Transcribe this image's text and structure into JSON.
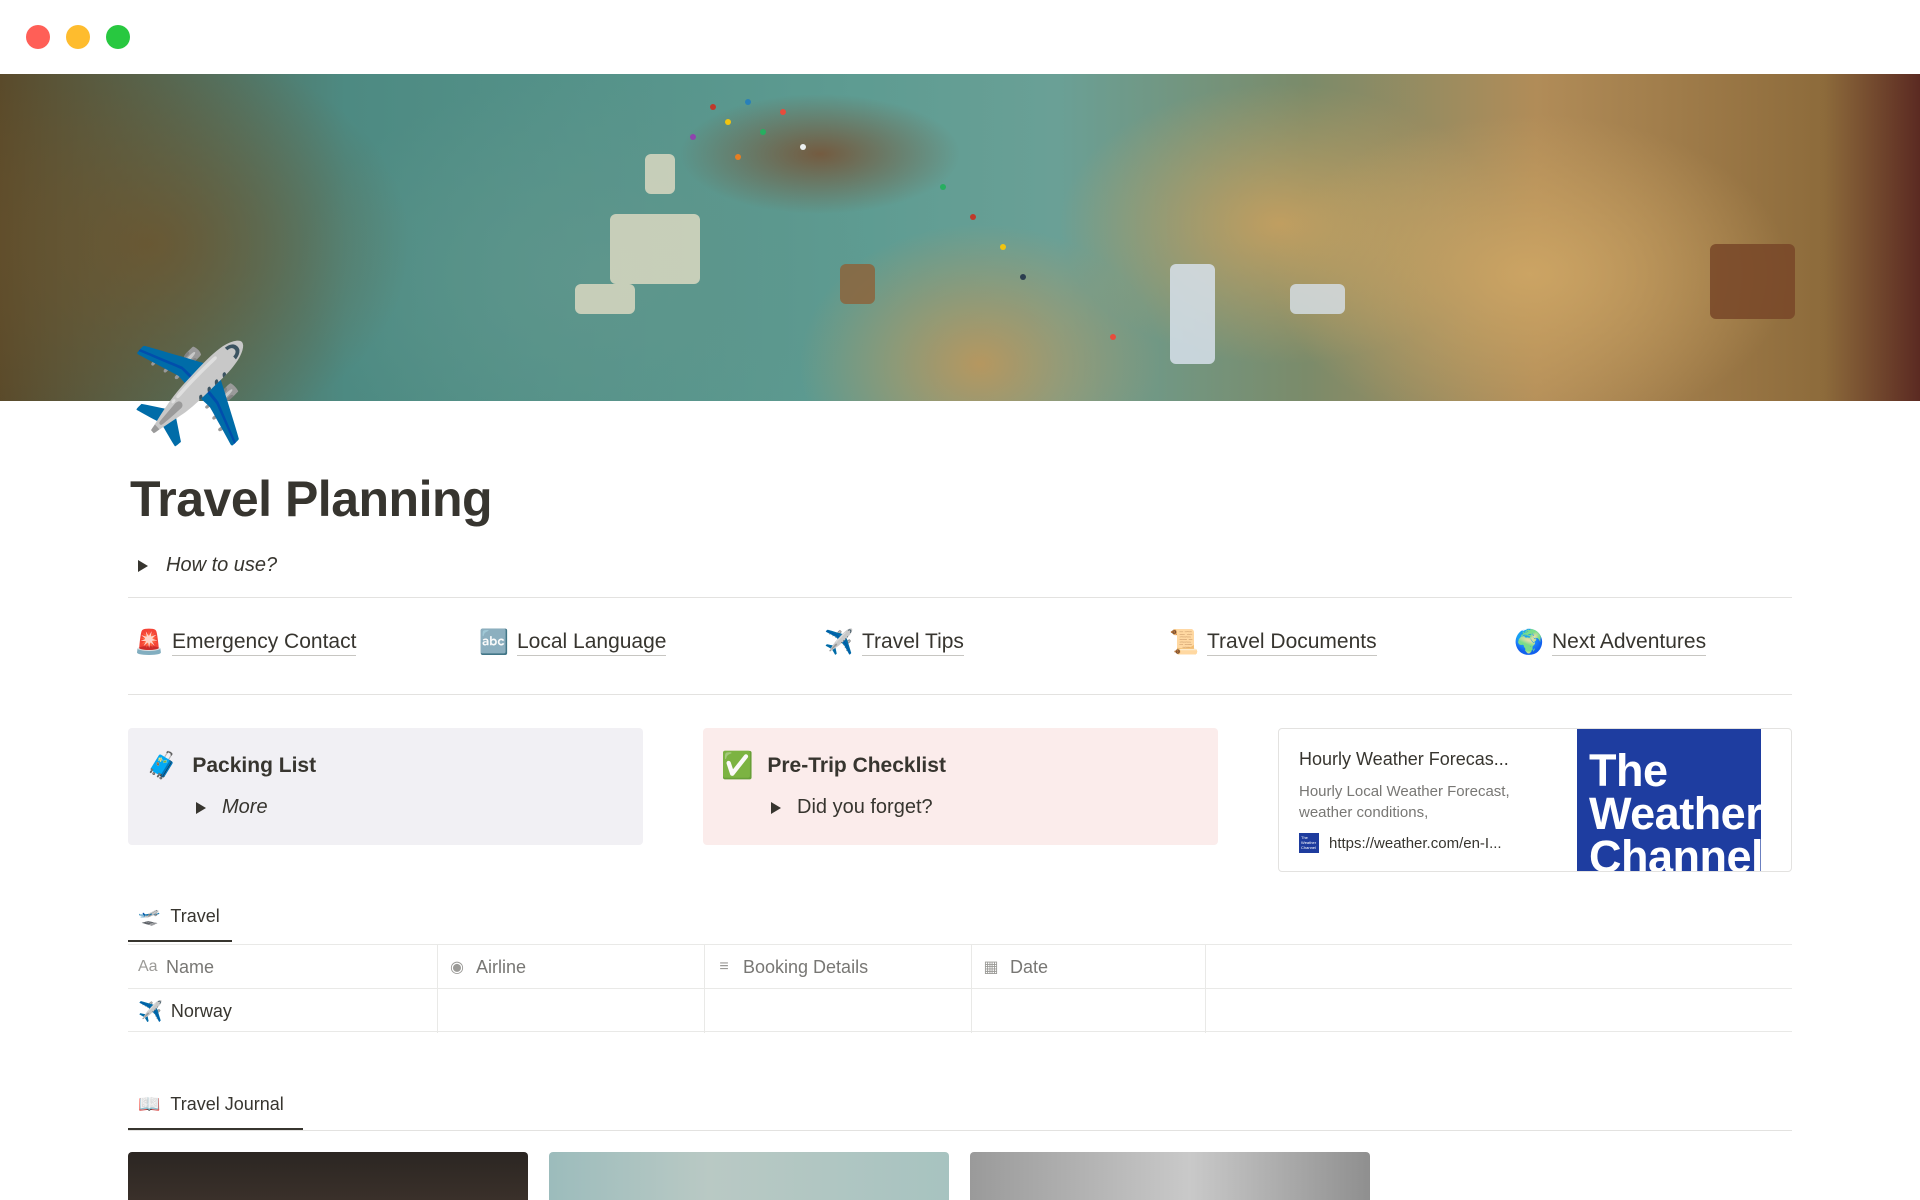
{
  "window": {
    "controls": [
      "close",
      "minimize",
      "maximize"
    ]
  },
  "page": {
    "icon": "✈️",
    "icon_name": "airplane-icon",
    "title": "Travel Planning",
    "toggle_label": "How to use?"
  },
  "links": [
    {
      "emoji": "🚨",
      "icon_name": "siren-icon",
      "label": "Emergency Contact"
    },
    {
      "emoji": "🔤",
      "icon_name": "abc-icon",
      "label": "Local Language"
    },
    {
      "emoji": "✈️",
      "icon_name": "airplane-icon",
      "label": "Travel Tips"
    },
    {
      "emoji": "📜",
      "icon_name": "scroll-icon",
      "label": "Travel Documents"
    },
    {
      "emoji": "🌍",
      "icon_name": "globe-icon",
      "label": "Next Adventures"
    }
  ],
  "callouts": {
    "packing": {
      "emoji": "🧳",
      "title": "Packing List",
      "toggle": "More",
      "bg": "#f1f0f4"
    },
    "pretrip": {
      "emoji": "✅",
      "title": "Pre-Trip Checklist",
      "toggle": "Did you forget?",
      "bg": "#fbeceb"
    }
  },
  "bookmark": {
    "title": "Hourly Weather Forecas...",
    "description": "Hourly Local Weather Forecast, weather conditions,",
    "url": "https://weather.com/en-I...",
    "image_text": "The Weather Channel",
    "favicon_text": "The Weather Channel",
    "brand_color": "#1e3da0"
  },
  "travel_db": {
    "tab_label": "Travel",
    "tab_icon": "departure-icon",
    "columns": [
      {
        "icon": "Aa",
        "label": "Name"
      },
      {
        "icon": "◉",
        "label": "Airline"
      },
      {
        "icon": "≡",
        "label": "Booking Details"
      },
      {
        "icon": "▦",
        "label": "Date"
      }
    ],
    "rows": [
      {
        "emoji": "✈️",
        "name": "Norway",
        "airline": "",
        "booking": "",
        "date": ""
      }
    ]
  },
  "journal": {
    "tab_label": "Travel Journal",
    "tab_icon": "book-icon"
  }
}
